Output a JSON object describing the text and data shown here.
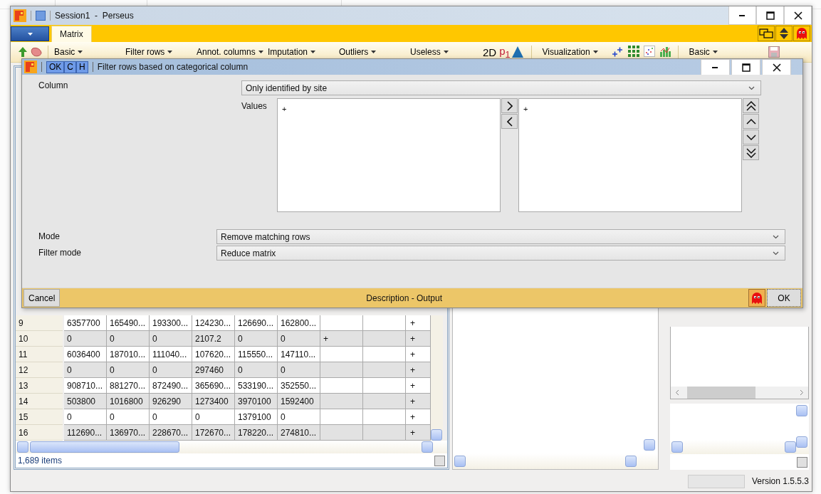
{
  "window": {
    "title": "Session1  -  Perseus",
    "tabs": [
      {
        "label": "Matrix",
        "selected": true
      }
    ],
    "toolbar": [
      {
        "kind": "menu",
        "label": "Basic"
      },
      {
        "kind": "menu",
        "label": "Filter rows"
      },
      {
        "kind": "menu",
        "label": "Annot. columns"
      },
      {
        "kind": "menu",
        "label": "Imputation"
      },
      {
        "kind": "menu",
        "label": "Outliers"
      },
      {
        "kind": "menu",
        "label": "Useless"
      },
      {
        "kind": "glyph",
        "label": "2D",
        "color": "#000000"
      },
      {
        "kind": "glyph",
        "label": "p$_{1}$",
        "color": "#c0203a"
      },
      {
        "kind": "peak"
      },
      {
        "kind": "menu",
        "label": "Visualization"
      },
      {
        "kind": "charts"
      },
      {
        "kind": "menu",
        "label": "Basic"
      },
      {
        "kind": "save"
      }
    ],
    "progress": {
      "level": 0
    },
    "version": "Version 1.5.5.3"
  },
  "table": {
    "rows": [
      {
        "number": "9",
        "cells": [
          "6357700",
          "165490...",
          "193300...",
          "124230...",
          "126690...",
          "162800...",
          null,
          null,
          "+"
        ]
      },
      {
        "number": "10",
        "cells": [
          "0",
          "0",
          "0",
          "2107.2",
          "0",
          "0",
          "+",
          null,
          "+"
        ]
      },
      {
        "number": "11",
        "cells": [
          "6036400",
          "187010...",
          "111040...",
          "107620...",
          "115550...",
          "147110...",
          null,
          null,
          "+"
        ]
      },
      {
        "number": "12",
        "cells": [
          "0",
          "0",
          "0",
          "297460",
          "0",
          "0",
          null,
          null,
          "+"
        ]
      },
      {
        "number": "13",
        "cells": [
          "908710...",
          "881270...",
          "872490...",
          "365690...",
          "533190...",
          "352550...",
          null,
          null,
          "+"
        ]
      },
      {
        "number": "14",
        "cells": [
          "503800",
          "1016800",
          "926290",
          "1273400",
          "3970100",
          "1592400",
          null,
          null,
          "+"
        ]
      },
      {
        "number": "15",
        "cells": [
          "0",
          "0",
          "0",
          "0",
          "1379100",
          "0",
          null,
          null,
          "+"
        ]
      },
      {
        "number": "16",
        "cells": [
          "112690...",
          "136970...",
          "228670...",
          "172670...",
          "178220...",
          "274810...",
          null,
          null,
          "+"
        ]
      }
    ],
    "footer": "1,689 items"
  },
  "dialog": {
    "title": "Filter rows based on categorical column",
    "title_buttons": [
      "OK",
      "C",
      "H"
    ],
    "column": {
      "label": "Column",
      "value": "Only identified by site"
    },
    "values": {
      "label": "Values",
      "available": [
        "+"
      ],
      "selected": [
        "+"
      ]
    },
    "mode": {
      "label": "Mode",
      "value": "Remove matching rows"
    },
    "filter_mode": {
      "label": "Filter mode",
      "value": "Reduce matrix"
    },
    "cancel": "Cancel",
    "footer": "Description - Output",
    "ok": "OK"
  }
}
